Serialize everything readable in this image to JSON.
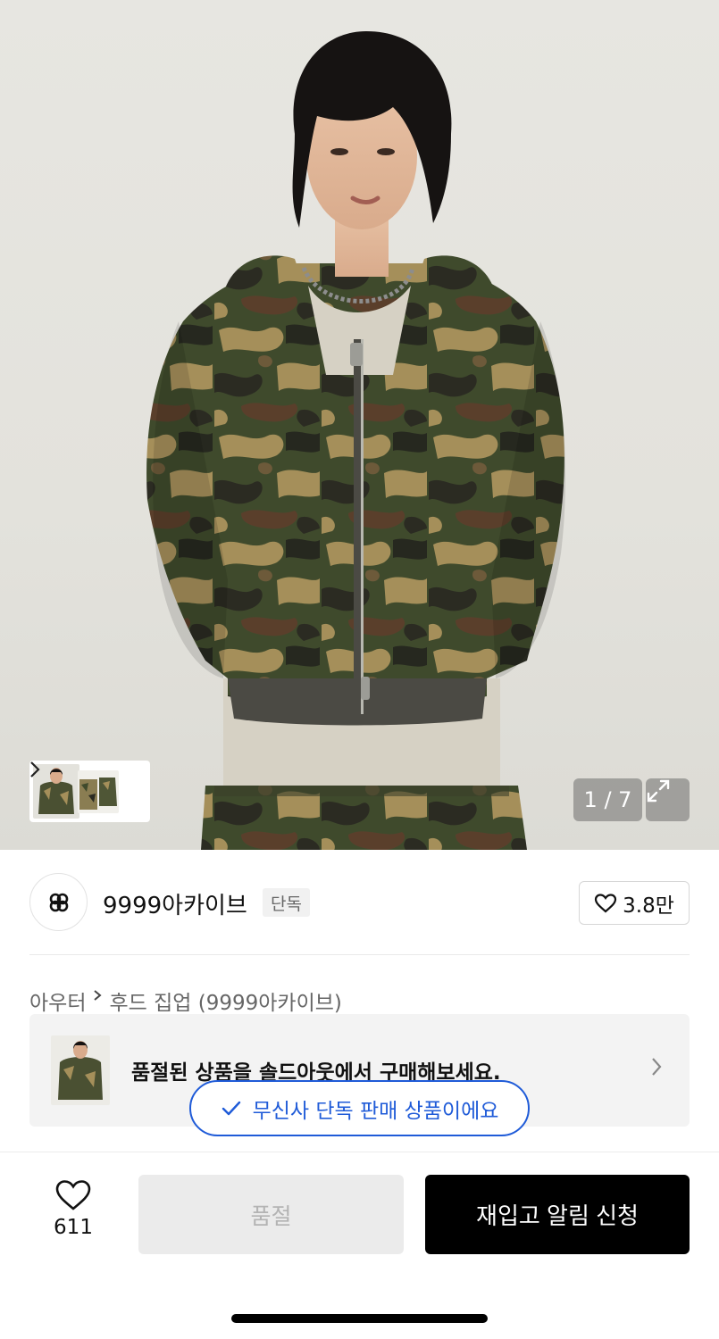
{
  "gallery": {
    "counter": "1 / 7",
    "thumbnails": [
      "front-view",
      "camo-flat-1",
      "camo-flat-2"
    ],
    "expand_icon": "expand-icon",
    "next_icon": "chevron-right-icon"
  },
  "brand": {
    "name": "9999아카이브",
    "exclusive_label": "단독",
    "likes": "3.8만",
    "logo_icon": "brand-logo-icon"
  },
  "breadcrumb": {
    "category": "아우터",
    "subcategory": "후드 집업 (9999아카이브)"
  },
  "soldout_banner": {
    "text": "품절된 상품을 솔드아웃에서 구매해보세요."
  },
  "exclusive_notice": {
    "text": "무신사 단독 판매 상품이에요",
    "icon": "check-icon"
  },
  "bottom_bar": {
    "wish_count": "611",
    "soldout_label": "품절",
    "restock_label": "재입고 알림 신청"
  },
  "colors": {
    "accent_blue": "#1f5bd8",
    "primary_black": "#000000",
    "disabled_bg": "#ebebeb"
  }
}
